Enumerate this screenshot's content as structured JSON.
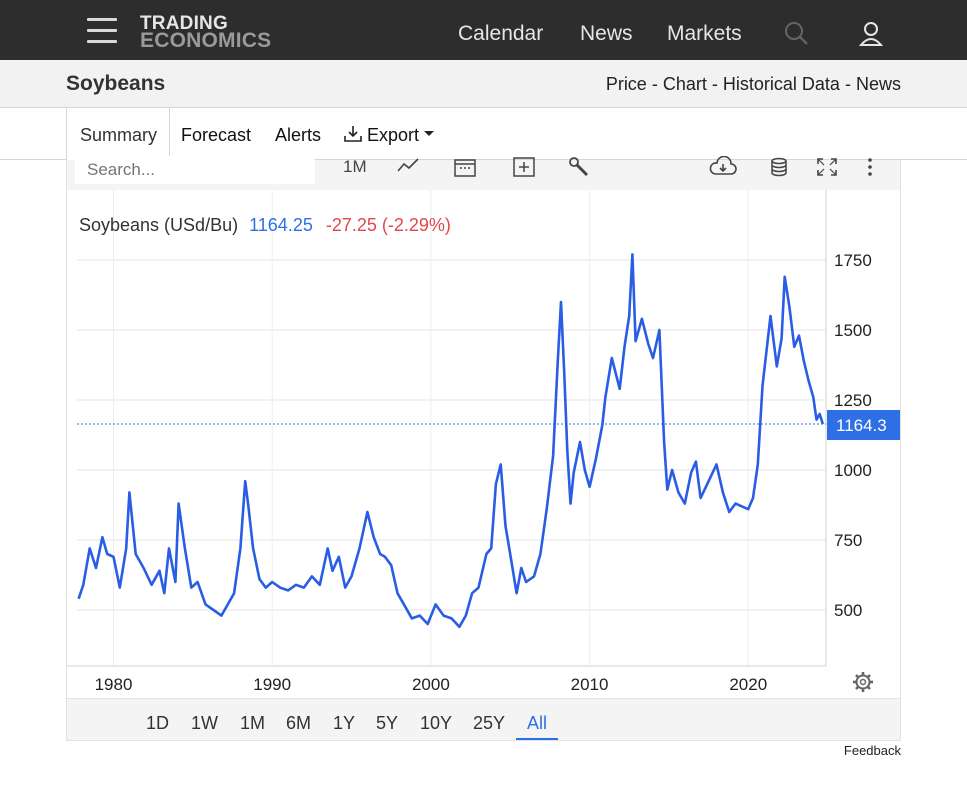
{
  "nav": {
    "logo_line1": "TRADING",
    "logo_line2": "ECONOMICS",
    "links": [
      "Calendar",
      "News",
      "Markets"
    ],
    "icons": [
      "menu-icon",
      "search-icon",
      "user-icon"
    ]
  },
  "title_bar": {
    "title": "Soybeans",
    "links": [
      "Price",
      "Chart",
      "Historical Data",
      "News"
    ],
    "separator": "-"
  },
  "tabs": {
    "summary": "Summary",
    "forecast": "Forecast",
    "alerts": "Alerts",
    "export": "Export"
  },
  "toolbar": {
    "search_placeholder": "Search...",
    "interval": "1M",
    "icons": [
      "line-chart-icon",
      "calendar-icon",
      "add-compare-icon",
      "wrench-icon",
      "cloud-download-icon",
      "database-icon",
      "fullscreen-icon",
      "more-icon"
    ]
  },
  "legend": {
    "series_name": "Soybeans (USd/Bu)",
    "last": "1164.25",
    "change": "-27.25 (-2.29%)",
    "last_color": "#2f6fe5",
    "change_color": "#e0474c"
  },
  "price_label": "1164.3",
  "ranges": [
    "1D",
    "1W",
    "1M",
    "6M",
    "1Y",
    "5Y",
    "10Y",
    "25Y",
    "All"
  ],
  "active_range": "All",
  "feedback": "Feedback",
  "chart_data": {
    "type": "line",
    "title": "",
    "xlabel": "",
    "ylabel": "",
    "x_ticks": [
      1980,
      1990,
      2000,
      2010,
      2020
    ],
    "y_ticks": [
      500,
      750,
      1000,
      1250,
      1500,
      1750
    ],
    "xlim": [
      1977.7,
      2024.9
    ],
    "ylim": [
      300,
      2000
    ],
    "grid": true,
    "line_color": "#2a5de6",
    "last_value": 1164.25,
    "series": [
      {
        "x": [
          1977.8,
          1978.1,
          1978.5,
          1978.9,
          1979.3,
          1979.6,
          1980.0,
          1980.4,
          1980.8,
          1981.0,
          1981.4,
          1981.9,
          1982.4,
          1982.9,
          1983.2,
          1983.5,
          1983.9,
          1984.1,
          1984.5,
          1984.9,
          1985.3,
          1985.8,
          1986.3,
          1986.8,
          1987.2,
          1987.6,
          1988.0,
          1988.3,
          1988.5,
          1988.8,
          1989.2,
          1989.6,
          1990.0,
          1990.5,
          1991.0,
          1991.5,
          1992.0,
          1992.5,
          1993.0,
          1993.5,
          1993.8,
          1994.2,
          1994.6,
          1995.0,
          1995.5,
          1996.0,
          1996.4,
          1996.8,
          1997.1,
          1997.5,
          1997.9,
          1998.4,
          1998.8,
          1999.3,
          1999.8,
          2000.3,
          2000.8,
          2001.3,
          2001.8,
          2002.2,
          2002.6,
          2003.0,
          2003.5,
          2003.8,
          2004.1,
          2004.4,
          2004.7,
          2005.0,
          2005.4,
          2005.7,
          2006.0,
          2006.5,
          2006.9,
          2007.3,
          2007.7,
          2008.0,
          2008.2,
          2008.4,
          2008.6,
          2008.8,
          2009.0,
          2009.4,
          2009.7,
          2010.0,
          2010.4,
          2010.8,
          2011.0,
          2011.4,
          2011.9,
          2012.2,
          2012.5,
          2012.7,
          2012.9,
          2013.3,
          2013.7,
          2014.0,
          2014.4,
          2014.7,
          2014.9,
          2015.2,
          2015.6,
          2016.0,
          2016.4,
          2016.7,
          2017.0,
          2017.5,
          2018.0,
          2018.4,
          2018.8,
          2019.2,
          2019.6,
          2020.0,
          2020.3,
          2020.6,
          2020.9,
          2021.1,
          2021.4,
          2021.8,
          2022.1,
          2022.3,
          2022.6,
          2022.9,
          2023.2,
          2023.5,
          2023.8,
          2024.1,
          2024.3,
          2024.5,
          2024.7
        ],
        "values": [
          540,
          590,
          720,
          650,
          760,
          700,
          690,
          580,
          720,
          920,
          700,
          650,
          590,
          640,
          560,
          720,
          600,
          880,
          720,
          580,
          600,
          520,
          500,
          480,
          520,
          560,
          720,
          960,
          870,
          720,
          610,
          580,
          600,
          580,
          570,
          590,
          580,
          620,
          590,
          720,
          640,
          690,
          580,
          620,
          720,
          850,
          760,
          700,
          690,
          660,
          560,
          510,
          470,
          480,
          450,
          520,
          480,
          470,
          440,
          480,
          560,
          580,
          700,
          720,
          950,
          1020,
          800,
          700,
          560,
          650,
          600,
          620,
          700,
          860,
          1050,
          1390,
          1600,
          1350,
          1070,
          880,
          990,
          1100,
          1000,
          940,
          1040,
          1160,
          1260,
          1400,
          1290,
          1440,
          1550,
          1770,
          1460,
          1540,
          1450,
          1400,
          1500,
          1100,
          930,
          1000,
          920,
          880,
          990,
          1030,
          900,
          960,
          1020,
          920,
          850,
          880,
          870,
          860,
          900,
          1020,
          1300,
          1400,
          1550,
          1370,
          1470,
          1690,
          1580,
          1440,
          1480,
          1390,
          1320,
          1260,
          1180,
          1200,
          1164.25
        ]
      }
    ]
  }
}
